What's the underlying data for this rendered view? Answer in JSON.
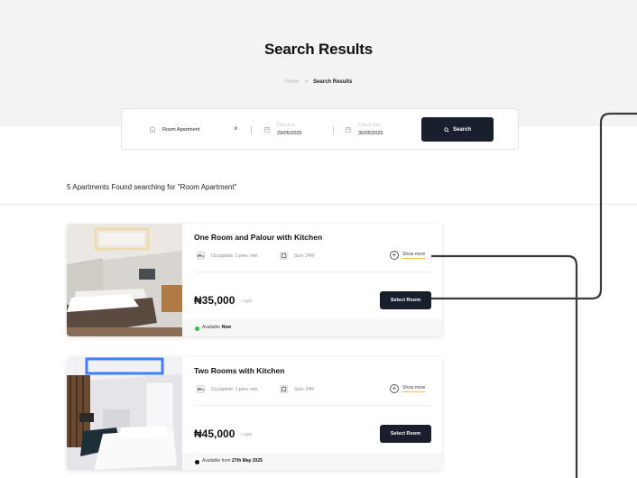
{
  "hero": {
    "title": "Search Results",
    "breadcrumb_home": "Home",
    "breadcrumb_sep": ">",
    "breadcrumb_current": "Search Results"
  },
  "search": {
    "query": "Room Apartment",
    "clear_label": "×",
    "checkin_label": "Check-in",
    "checkin_value": "29/05/2025",
    "checkout_label": "Check-Out",
    "checkout_value": "30/05/2025",
    "button_label": "Search"
  },
  "results_summary": "5 Apartments Found searching for \"Room Apartment\"",
  "cards": [
    {
      "title": "One Room and Palour with Kitchen",
      "occupants": "Occupants: 1 pers. min.",
      "size": "Size: 24ft²",
      "show_more": "Show more",
      "price": "₦35,000",
      "per_night": "/ night",
      "select_label": "Select Room",
      "availability_prefix": "Available",
      "availability_value": "Now",
      "availability_color": "#2fbf4a"
    },
    {
      "title": "Two Rooms with Kitchen",
      "occupants": "Occupants: 1 pers. min.",
      "size": "Size: 24ft²",
      "show_more": "Show more",
      "price": "₦45,000",
      "per_night": "/ night",
      "select_label": "Select Room",
      "availability_prefix": "Available from",
      "availability_value": "27th May 2025",
      "availability_color": "#111111"
    }
  ],
  "icons": {
    "search_field": "building-icon",
    "calendar": "calendar-icon",
    "search_button": "search-icon",
    "bed": "bed-icon",
    "size": "area-icon",
    "plus": "plus-circle-icon"
  },
  "colors": {
    "hero_bg": "#f3f3f3",
    "button_bg": "#191f2c",
    "underline_accent": "#f0c040",
    "connector": "#3a3a3a"
  }
}
